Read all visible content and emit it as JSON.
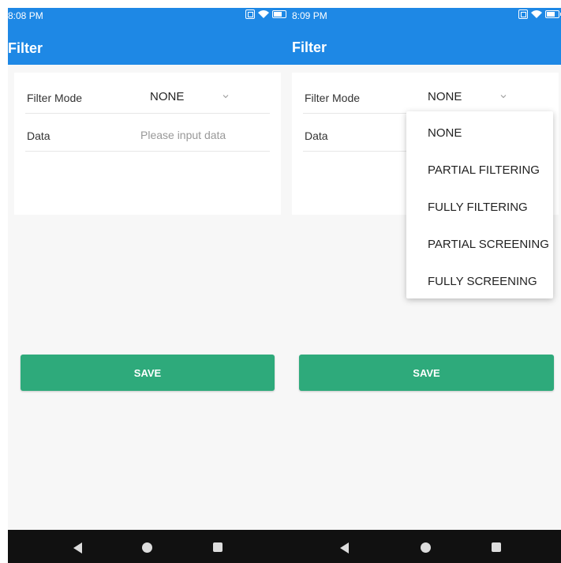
{
  "left_screen": {
    "status_time": "8:08 PM",
    "title": "Filter",
    "form": {
      "filter_mode_label": "Filter Mode",
      "filter_mode_value": "NONE",
      "data_label": "Data",
      "data_value": "",
      "data_placeholder": "Please input data"
    },
    "save_label": "SAVE"
  },
  "right_screen": {
    "status_time": "8:09 PM",
    "title": "Filter",
    "form": {
      "filter_mode_label": "Filter Mode",
      "filter_mode_value": "NONE",
      "data_label": "Data"
    },
    "dropdown_options": [
      "NONE",
      "PARTIAL FILTERING",
      "FULLY FILTERING",
      "PARTIAL SCREENING",
      "FULLY SCREENING"
    ],
    "save_label": "SAVE"
  },
  "status_icons": [
    "qr-icon",
    "wifi-icon",
    "battery-icon"
  ],
  "nav_icons": [
    "back-icon",
    "home-icon",
    "recent-apps-icon"
  ],
  "colors": {
    "app_bar": "#1e88e5",
    "save_button": "#2eaa7b",
    "background": "#f7f7f7",
    "nav_bar": "#111111"
  }
}
